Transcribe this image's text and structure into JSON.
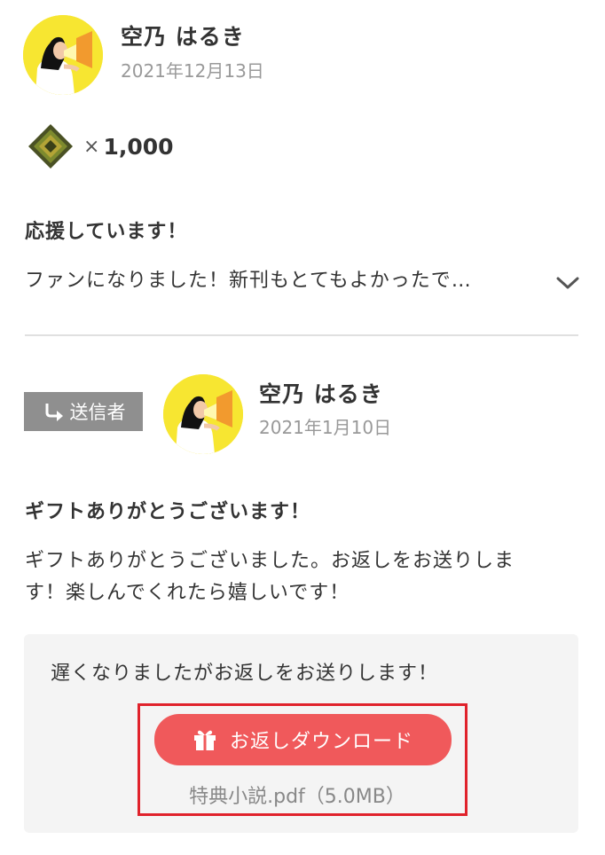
{
  "gift": {
    "sender_name": "空乃 はるき",
    "date": "2021年12月13日",
    "gem_count_prefix": "×",
    "gem_count": "1,000",
    "title": "応援しています！",
    "message_preview": "ファンになりました！新刊もとてもよかったで…",
    "expand_icon": "chevron-down-icon"
  },
  "reply": {
    "badge_label": "送信者",
    "badge_icon": "reply-arrow-icon",
    "sender_name": "空乃 はるき",
    "date": "2021年1月10日",
    "title": "ギフトありがとうございます！",
    "message_line1": "ギフトありがとうございました。お返しをお送りしま",
    "message_line2": "す！楽しんでくれたら嬉しいです！",
    "return_note": "遅くなりましたがお返しをお送りします！",
    "download_label": "お返しダウンロード",
    "download_icon": "gift-icon",
    "file_info": "特典小説.pdf（5.0MB）"
  },
  "colors": {
    "accent": "#f0595b",
    "highlight": "#e0222b",
    "avatar_bg": "#f7e631",
    "badge_bg": "#8f8f8f"
  }
}
